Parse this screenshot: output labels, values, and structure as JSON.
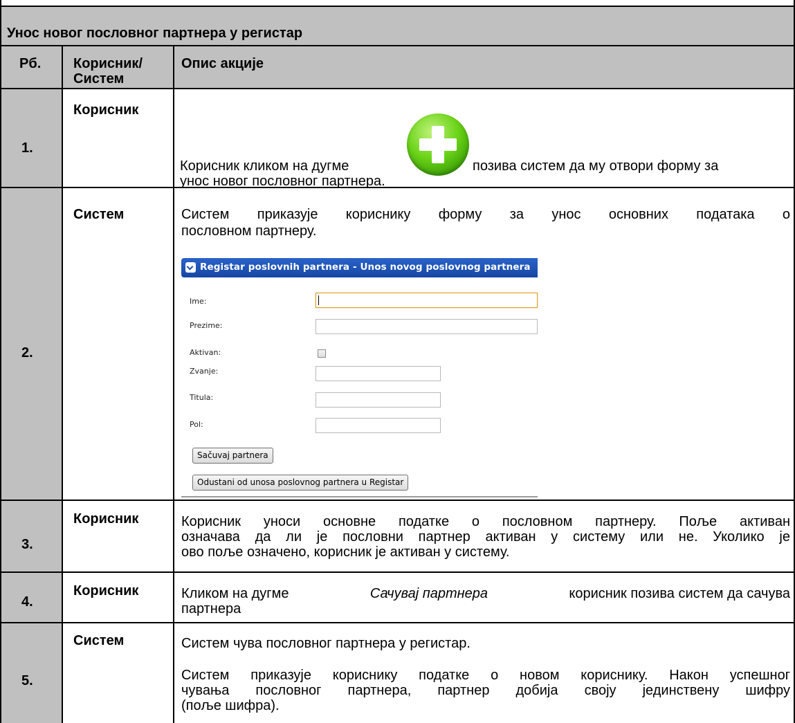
{
  "table": {
    "title": "Унос новог пословног партнера у регистар",
    "headers": {
      "num": "Рб.",
      "actor_line1": "Корисник/",
      "actor_line2": "Систем",
      "desc": "Опис акције"
    },
    "rows": [
      {
        "num": "1.",
        "actor": "Корисник",
        "text_before": "Корисник кликом на дугме",
        "text_after": "позива систем да му отвори форму за",
        "text_line2": "унос новог пословног партнера.",
        "icon": "green-plus-icon"
      },
      {
        "num": "2.",
        "actor": "Систем",
        "line1": "Систем приказује кориснику форму за унос основних података о",
        "line2": "пословном партнеру."
      },
      {
        "num": "3.",
        "actor": "Корисник",
        "line1": "Корисник уноси основне податке о пословном партнеру. Поље активан",
        "line2": "означава да ли је пословни партнер активан у систему или не. Уколико је",
        "line3": "ово поље означено, корисник је активан у систему."
      },
      {
        "num": "4.",
        "actor": "Корисник",
        "line1_a": "Кликом на дугме",
        "line1_italic": "Сачувај партнера",
        "line1_b": "корисник позива систем да сачува",
        "line2": "партнера"
      },
      {
        "num": "5.",
        "actor": "Систем",
        "para1": "Систем чува пословног партнера у регистар.",
        "line1": "Систем приказује кориснику податке о новом кориснику. Након успешног",
        "line2": "чувања пословног партнера, партнер добија своју јединствену шифру",
        "line3": "(поље шифра)."
      }
    ]
  },
  "form": {
    "title": "Registar poslovnih partnera - Unos novog poslovnog partnera",
    "fields": {
      "ime": "Ime:",
      "prezime": "Prezime:",
      "aktivan": "Aktivan:",
      "zvanje": "Zvanje:",
      "titula": "Titula:",
      "pol": "Pol:"
    },
    "aktivan_checked": false,
    "save_button": "Sačuvaj partnera",
    "cancel_button": "Odustani od unosa poslovnog partnera u Registar"
  },
  "colors": {
    "header_grey": "#c0c0c0",
    "form_header_blue": "#1f55b8",
    "plus_green": "#5cc317"
  }
}
